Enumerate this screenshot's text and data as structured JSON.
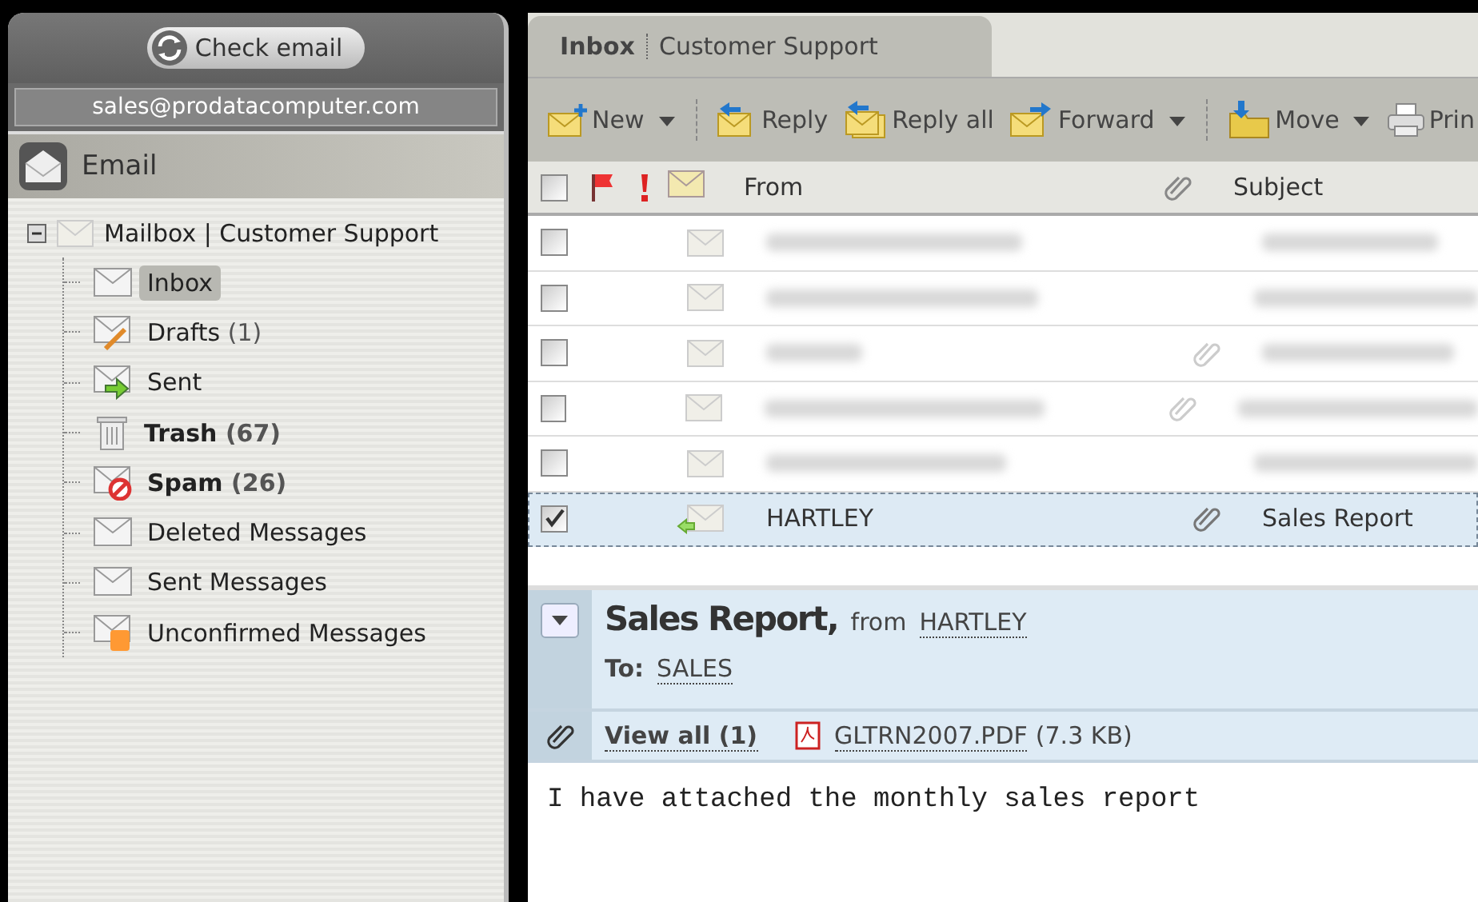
{
  "check_button": "Check email",
  "account": "sales@prodatacomputer.com",
  "section": "Email",
  "mailbox": {
    "label": "Mailbox | Customer Support",
    "expanded": true,
    "children": [
      {
        "label": "Inbox",
        "kind": "inbox",
        "selected": true,
        "bold": false
      },
      {
        "label": "Drafts",
        "count": "(1)",
        "kind": "drafts",
        "selected": false,
        "bold": false
      },
      {
        "label": "Sent",
        "kind": "sent",
        "selected": false,
        "bold": false
      },
      {
        "label": "Trash",
        "count": "(67)",
        "kind": "trash",
        "selected": false,
        "bold": true
      },
      {
        "label": "Spam",
        "count": "(26)",
        "kind": "spam",
        "selected": false,
        "bold": true
      },
      {
        "label": "Deleted Messages",
        "kind": "folder",
        "selected": false,
        "bold": false
      },
      {
        "label": "Sent Messages",
        "kind": "folder",
        "selected": false,
        "bold": false
      },
      {
        "label": "Unconfirmed Messages",
        "kind": "unconfirmed",
        "selected": false,
        "bold": false
      }
    ]
  },
  "tab": {
    "folder": "Inbox",
    "mailbox": "Customer Support"
  },
  "toolbar": [
    {
      "label": "New",
      "kind": "new",
      "dropdown": true,
      "separator_after": true
    },
    {
      "label": "Reply",
      "kind": "reply",
      "dropdown": false,
      "separator_after": false
    },
    {
      "label": "Reply all",
      "kind": "replyall",
      "dropdown": false,
      "separator_after": false
    },
    {
      "label": "Forward",
      "kind": "forward",
      "dropdown": true,
      "separator_after": true
    },
    {
      "label": "Move",
      "kind": "move",
      "dropdown": true,
      "separator_after": false
    },
    {
      "label": "Prin",
      "kind": "print",
      "dropdown": false,
      "separator_after": false
    }
  ],
  "columns": {
    "from": "From",
    "subject": "Subject",
    "select_all_checked": false
  },
  "rows": [
    {
      "blurred": true,
      "read": true,
      "attachment": false,
      "replied": false,
      "checked": false,
      "selected": false
    },
    {
      "blurred": true,
      "read": true,
      "attachment": false,
      "replied": false,
      "checked": false,
      "selected": false
    },
    {
      "blurred": true,
      "read": true,
      "attachment": true,
      "replied": false,
      "checked": false,
      "selected": false
    },
    {
      "blurred": true,
      "read": true,
      "attachment": true,
      "replied": false,
      "checked": false,
      "selected": false
    },
    {
      "blurred": true,
      "read": true,
      "attachment": false,
      "replied": false,
      "checked": false,
      "selected": false
    },
    {
      "blurred": false,
      "from": "HARTLEY",
      "subject": "Sales Report",
      "read": true,
      "attachment": true,
      "replied": true,
      "checked": true,
      "selected": true
    }
  ],
  "preview": {
    "subject": "Sales Report,",
    "from_label": "from",
    "from": "HARTLEY",
    "to_label": "To:",
    "to": "SALES",
    "view_all": "View all (1)",
    "file": "GLTRN2007.PDF",
    "size": "(7.3 KB)",
    "body": "I have attached the monthly sales report"
  }
}
